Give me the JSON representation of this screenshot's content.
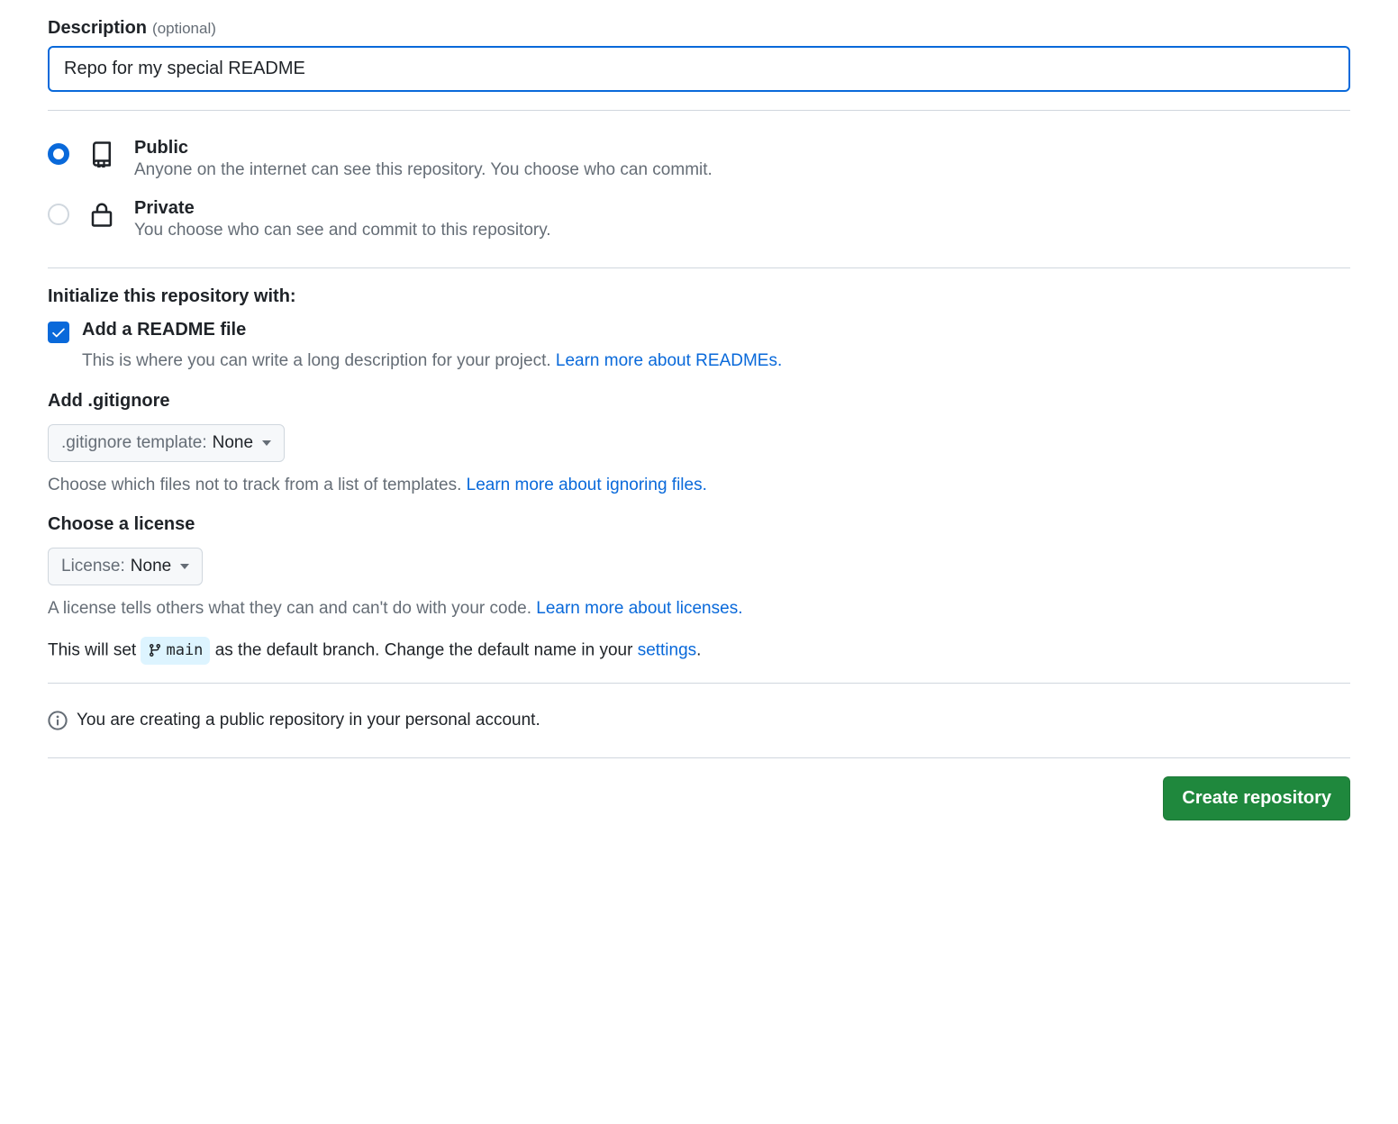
{
  "description": {
    "label": "Description",
    "optional": "(optional)",
    "value": "Repo for my special README"
  },
  "visibility": {
    "public": {
      "title": "Public",
      "desc": "Anyone on the internet can see this repository. You choose who can commit.",
      "selected": true
    },
    "private": {
      "title": "Private",
      "desc": "You choose who can see and commit to this repository.",
      "selected": false
    }
  },
  "initialize": {
    "heading": "Initialize this repository with:",
    "readme": {
      "checked": true,
      "label": "Add a README file",
      "desc": "This is where you can write a long description for your project. ",
      "link": "Learn more about READMEs."
    },
    "gitignore": {
      "heading": "Add .gitignore",
      "prefix": ".gitignore template: ",
      "value": "None",
      "desc": "Choose which files not to track from a list of templates. ",
      "link": "Learn more about ignoring files."
    },
    "license": {
      "heading": "Choose a license",
      "prefix": "License: ",
      "value": "None",
      "desc": "A license tells others what they can and can't do with your code. ",
      "link": "Learn more about licenses."
    }
  },
  "branch": {
    "prefix": "This will set ",
    "name": "main",
    "mid": " as the default branch. Change the default name in your ",
    "link": "settings",
    "suffix": "."
  },
  "info": {
    "text": "You are creating a public repository in your personal account."
  },
  "submit": {
    "label": "Create repository"
  }
}
